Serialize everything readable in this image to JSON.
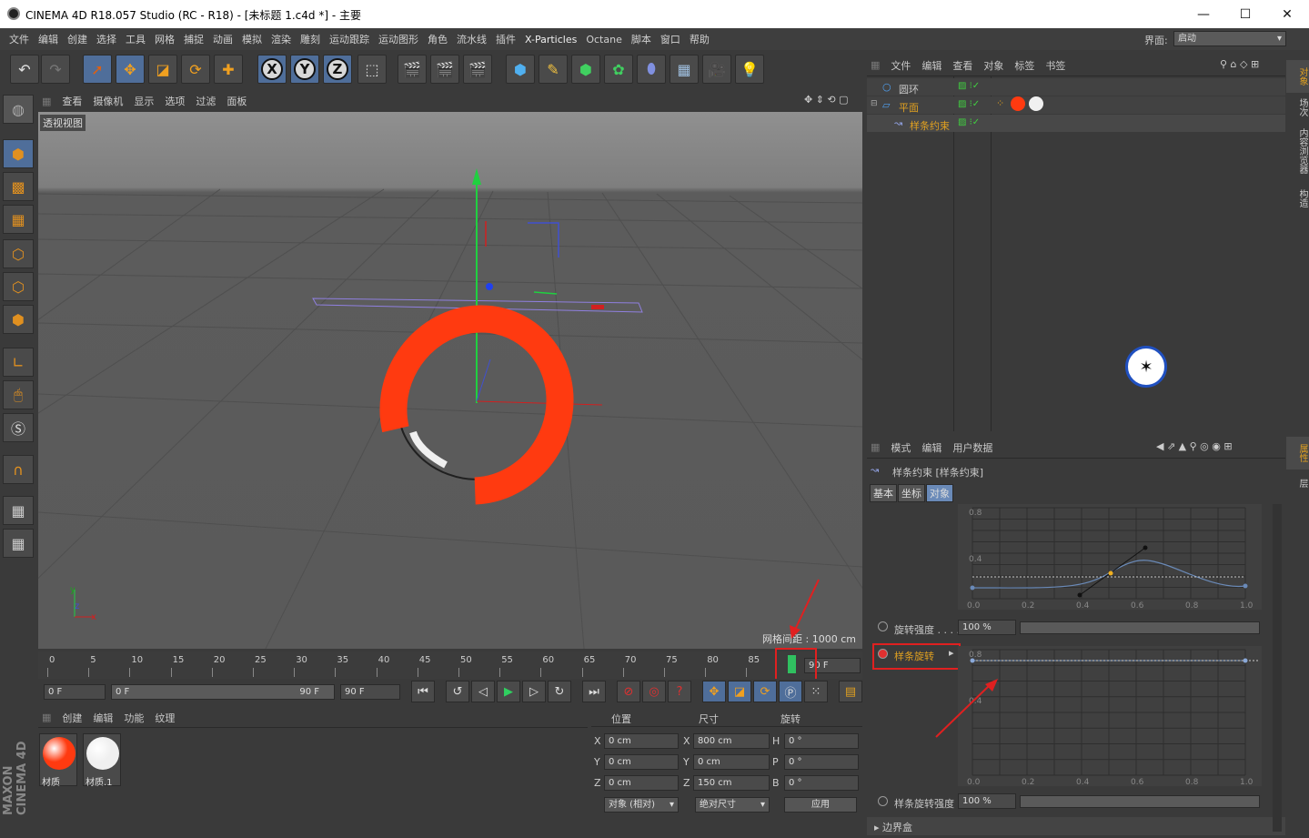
{
  "window": {
    "title": "CINEMA 4D R18.057 Studio (RC - R18) - [未标题 1.c4d *] - 主要",
    "min": "—",
    "max": "☐",
    "close": "✕"
  },
  "menu": [
    "文件",
    "编辑",
    "创建",
    "选择",
    "工具",
    "网格",
    "捕捉",
    "动画",
    "模拟",
    "渲染",
    "雕刻",
    "运动跟踪",
    "运动图形",
    "角色",
    "流水线",
    "插件",
    "X-Particles",
    "Octane",
    "脚本",
    "窗口",
    "帮助"
  ],
  "layout": {
    "label": "界面:",
    "value": "启动"
  },
  "toolbar": {
    "undo": "↶",
    "redo": "↷",
    "x": "X",
    "y": "Y",
    "z": "Z"
  },
  "viewport": {
    "menu": [
      "查看",
      "摄像机",
      "显示",
      "选项",
      "过滤",
      "面板"
    ],
    "label": "透视视图",
    "grid_info": "网格间距 : 1000 cm",
    "text_colors": {
      "text": "#ff3a10",
      "spline": "#9080e0"
    }
  },
  "timeline": {
    "ticks": [
      "0",
      "5",
      "10",
      "15",
      "20",
      "25",
      "30",
      "35",
      "40",
      "45",
      "50",
      "55",
      "60",
      "65",
      "70",
      "75",
      "80",
      "85"
    ],
    "current_frame": "90 F"
  },
  "transport": {
    "start": "0 F",
    "range_start": "0 F",
    "range_end": "90 F",
    "end": "90 F"
  },
  "materials": {
    "menu": [
      "创建",
      "编辑",
      "功能",
      "纹理"
    ],
    "items": [
      {
        "name": "材质",
        "color": "#ff3a10"
      },
      {
        "name": "材质.1",
        "color": "#f0f0f0"
      }
    ]
  },
  "coords": {
    "headers": [
      "位置",
      "尺寸",
      "旋转"
    ],
    "rows": [
      {
        "a": "X",
        "pos": "0 cm",
        "b": "X",
        "size": "800 cm",
        "c": "H",
        "rot": "0 °"
      },
      {
        "a": "Y",
        "pos": "0 cm",
        "b": "Y",
        "size": "0 cm",
        "c": "P",
        "rot": "0 °"
      },
      {
        "a": "Z",
        "pos": "0 cm",
        "b": "Z",
        "size": "150 cm",
        "c": "B",
        "rot": "0 °"
      }
    ],
    "mode1": "对象 (相对)",
    "mode2": "绝对尺寸",
    "apply": "应用"
  },
  "objects": {
    "menu": [
      "文件",
      "编辑",
      "查看",
      "对象",
      "标签",
      "书签"
    ],
    "items": [
      {
        "name": "圆环",
        "color": "#c8c8c8"
      },
      {
        "name": "平面",
        "color": "#e0a020"
      },
      {
        "name": "样条约束",
        "color": "#e0a020"
      }
    ]
  },
  "attributes": {
    "menu": [
      "模式",
      "编辑",
      "用户数据"
    ],
    "title": "样条约束 [样条约束]",
    "tabs": [
      "基本",
      "坐标",
      "对象"
    ],
    "graph1": {
      "y_labels": [
        "0.8",
        "0.4"
      ],
      "x_labels": [
        "0.0",
        "0.2",
        "0.4",
        "0.6",
        "0.8",
        "1.0"
      ]
    },
    "rot_strength": {
      "label": "旋转强度 . . . .",
      "value": "100 %"
    },
    "spline_rot": {
      "label": "样条旋转"
    },
    "graph2": {
      "y_labels": [
        "0.8",
        "0.4"
      ],
      "x_labels": [
        "0.0",
        "0.2",
        "0.4",
        "0.6",
        "0.8",
        "1.0"
      ]
    },
    "spline_rot_strength": {
      "label": "样条旋转强度",
      "value": "100 %"
    },
    "bbox": "▸ 边界盒"
  },
  "right_tabs": [
    "对象",
    "场次",
    "内容浏览器",
    "构造",
    "属性",
    "层"
  ],
  "brand": "MAXON CINEMA 4D"
}
